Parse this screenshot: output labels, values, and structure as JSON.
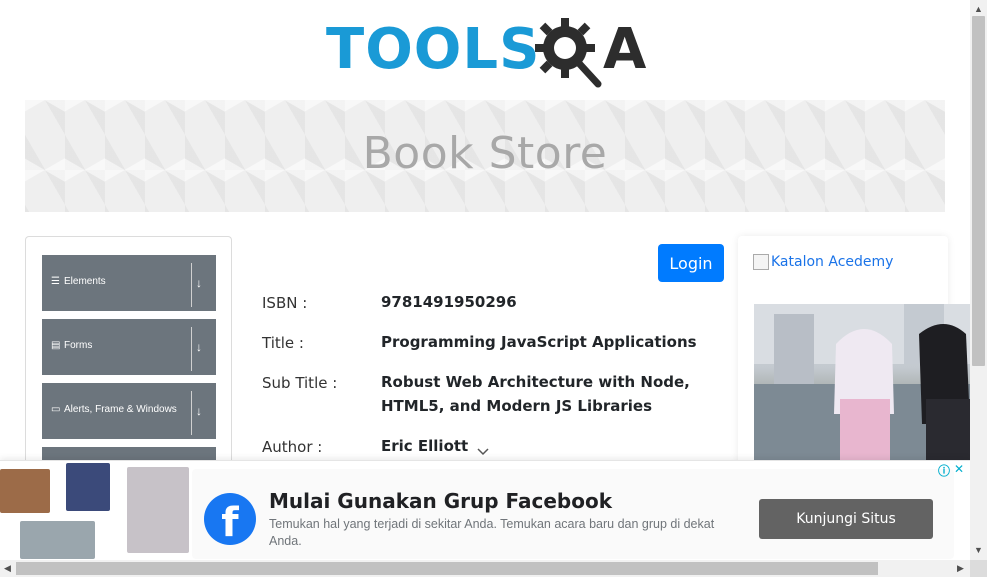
{
  "logo": {
    "part1": "TOOLS",
    "part2": "QA"
  },
  "banner": {
    "title": "Book Store"
  },
  "sidebar": {
    "groups": [
      {
        "label": "Elements",
        "icon": "hamburger-icon"
      },
      {
        "label": "Forms",
        "icon": "form-icon"
      },
      {
        "label": "Alerts, Frame & Windows",
        "icon": "window-icon"
      }
    ],
    "download_icon": "↓"
  },
  "login": {
    "label": "Login"
  },
  "book": {
    "isbn_label": "ISBN :",
    "isbn": "9781491950296",
    "title_label": "Title :",
    "title": "Programming JavaScript Applications",
    "subtitle_label": "Sub Title :",
    "subtitle": "Robust Web Architecture with Node, HTML5, and Modern JS Libraries",
    "author_label": "Author :",
    "author": "Eric Elliott"
  },
  "right_ad": {
    "alt_text": "Katalon Acedemy"
  },
  "bottom_ad": {
    "title": "Mulai Gunakan Grup Facebook",
    "description": "Temukan hal yang terjadi di sekitar Anda. Temukan acara baru dan grup di dekat Anda.",
    "cta": "Kunjungi Situs",
    "brand_letter": "f"
  },
  "colors": {
    "primary": "#007bff",
    "sidebar_group": "#6c757d",
    "facebook": "#1877f2",
    "logo_blue": "#1a9ad6"
  }
}
